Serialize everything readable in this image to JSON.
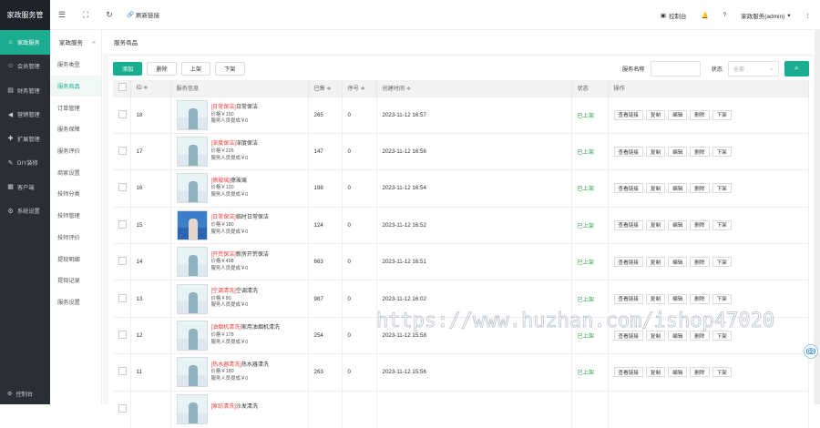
{
  "app": {
    "brand": "家政服务管"
  },
  "sidebar": {
    "items": [
      {
        "label": "家政服务",
        "icon": "home-icon",
        "active": true
      },
      {
        "label": "会员管理",
        "icon": "user-icon"
      },
      {
        "label": "财务管理",
        "icon": "wallet-icon"
      },
      {
        "label": "营销管理",
        "icon": "megaphone-icon"
      },
      {
        "label": "扩展管理",
        "icon": "puzzle-icon"
      },
      {
        "label": "DIY装修",
        "icon": "paint-icon"
      },
      {
        "label": "客户端",
        "icon": "grid-icon"
      },
      {
        "label": "系统设置",
        "icon": "settings-icon"
      }
    ],
    "bottom": "控制台"
  },
  "topbar": {
    "refresh_link": "刷新链接",
    "console": "控制台",
    "user": "家政服务(admin)"
  },
  "subnav": {
    "title": "家政服务",
    "items": [
      "服务类型",
      "服务商品",
      "订单管理",
      "服务保障",
      "服务评价",
      "商家设置",
      "技师分类",
      "技师管理",
      "技师评价",
      "提现明细",
      "提现记录",
      "服务设置"
    ],
    "active_index": 1
  },
  "breadcrumb": "服务商品",
  "toolbar": {
    "add": "添加",
    "delete": "删除",
    "on_shelf": "上架",
    "off_shelf": "下架"
  },
  "filters": {
    "name_label": "服务名称",
    "status_label": "状态",
    "status_value": "全部"
  },
  "table": {
    "headers": [
      "ID ≑",
      "服务信息",
      "已售 ≑",
      "序号 ≑",
      "创建时间 ≑",
      "状态",
      "操作"
    ],
    "ops": [
      "查看链接",
      "复制",
      "编辑",
      "删除",
      "下架"
    ],
    "rows": [
      {
        "id": "18",
        "tag": "[日常保洁]",
        "name": "日常保洁",
        "price": "价格￥150",
        "commission": "服务人员提成￥0",
        "sold": "265",
        "seq": "0",
        "created": "2023-11-12 16:57",
        "status": "已上架"
      },
      {
        "id": "17",
        "tag": "[深度保洁]",
        "name": "深度保洁",
        "price": "价格￥226",
        "commission": "服务人员提成￥0",
        "sold": "147",
        "seq": "0",
        "created": "2023-11-12 16:56",
        "status": "已上架"
      },
      {
        "id": "16",
        "tag": "[擦玻璃]",
        "name": "擦玻璃",
        "price": "价格￥120",
        "commission": "服务人员提成￥0",
        "sold": "198",
        "seq": "0",
        "created": "2023-11-12 16:54",
        "status": "已上架"
      },
      {
        "id": "15",
        "tag": "[日常保洁]",
        "name": "临时日常保洁",
        "price": "价格￥180",
        "commission": "服务人员提成￥0",
        "sold": "124",
        "seq": "0",
        "created": "2023-11-12 16:52",
        "status": "已上架"
      },
      {
        "id": "14",
        "tag": "[开荒保洁]",
        "name": "新房开荒保洁",
        "price": "价格￥498",
        "commission": "服务人员提成￥0",
        "sold": "663",
        "seq": "0",
        "created": "2023-11-12 16:51",
        "status": "已上架"
      },
      {
        "id": "13",
        "tag": "[空调清洗]",
        "name": "空调清洗",
        "price": "价格￥80",
        "commission": "服务人员提成￥0",
        "sold": "987",
        "seq": "0",
        "created": "2023-11-12 16:02",
        "status": "已上架"
      },
      {
        "id": "12",
        "tag": "[油烟机清洗]",
        "name": "家用油烟机清洗",
        "price": "价格￥178",
        "commission": "服务人员提成￥0",
        "sold": "254",
        "seq": "0",
        "created": "2023-11-12 15:58",
        "status": "已上架"
      },
      {
        "id": "11",
        "tag": "[热水器清洗]",
        "name": "热水器清洗",
        "price": "价格￥180",
        "commission": "服务人员提成￥0",
        "sold": "263",
        "seq": "0",
        "created": "2023-11-12 15:56",
        "status": "已上架"
      },
      {
        "id": "",
        "tag": "[家纺清洗]",
        "name": "沙发清洗",
        "price": "",
        "commission": "",
        "sold": "",
        "seq": "",
        "created": "",
        "status": ""
      }
    ]
  },
  "watermark": "https://www.huzhan.com/ishop47020"
}
